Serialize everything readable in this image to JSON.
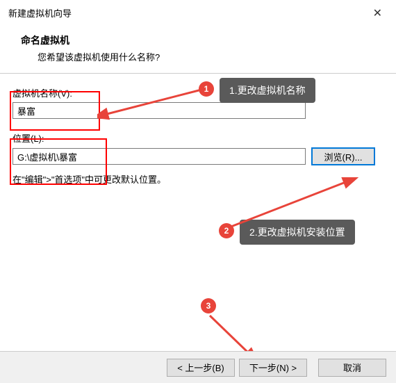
{
  "titlebar": {
    "title": "新建虚拟机向导"
  },
  "header": {
    "title": "命名虚拟机",
    "subtitle": "您希望该虚拟机使用什么名称?"
  },
  "fields": {
    "name_label": "虚拟机名称(V):",
    "name_value": "暴富",
    "location_label": "位置(L):",
    "location_value": "G:\\虚拟机\\暴富",
    "browse_label": "浏览(R)..."
  },
  "hint": "在\"编辑\">\"首选项\"中可更改默认位置。",
  "footer": {
    "back": "< 上一步(B)",
    "next": "下一步(N) >",
    "cancel": "取消"
  },
  "annotations": {
    "badge1": "1",
    "label1": "1.更改虚拟机名称",
    "badge2": "2",
    "label2": "2.更改虚拟机安装位置",
    "badge3": "3"
  }
}
